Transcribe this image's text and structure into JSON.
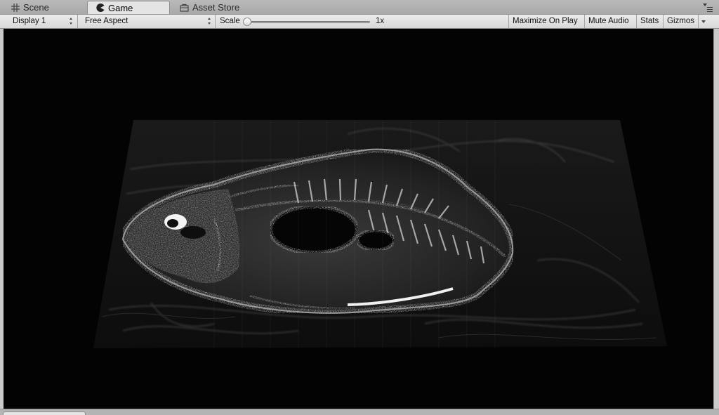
{
  "tabs": [
    {
      "label": "Scene",
      "icon": "grid-icon",
      "active": false
    },
    {
      "label": "Game",
      "icon": "pacman-icon",
      "active": true
    },
    {
      "label": "Asset Store",
      "icon": "store-bag-icon",
      "active": false
    }
  ],
  "toolbar": {
    "display": "Display 1",
    "aspect": "Free Aspect",
    "scale_label": "Scale",
    "scale_value": "1x",
    "scale_level": 0.0,
    "maximize": "Maximize On Play",
    "mute": "Mute Audio",
    "stats": "Stats",
    "gizmos": "Gizmos"
  },
  "viewport": {
    "content": "volume-rendered-fish-scan",
    "background": "#030303"
  }
}
